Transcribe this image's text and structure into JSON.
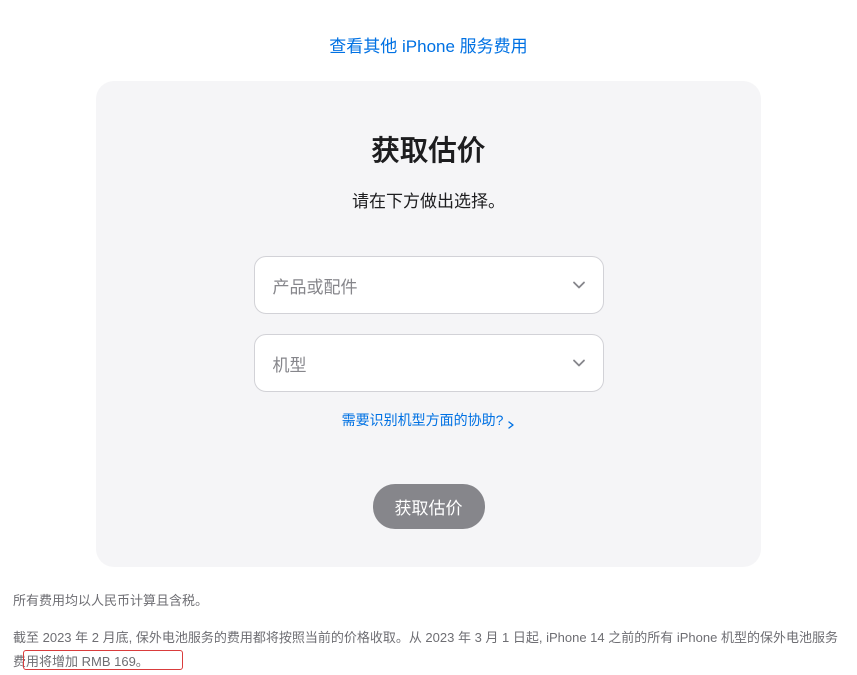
{
  "top_link": "查看其他 iPhone 服务费用",
  "card": {
    "title": "获取估价",
    "subtitle": "请在下方做出选择。",
    "select_product_placeholder": "产品或配件",
    "select_model_placeholder": "机型",
    "help_link": "需要识别机型方面的协助?",
    "submit_label": "获取估价"
  },
  "footnotes": {
    "line1": "所有费用均以人民币计算且含税。",
    "line2": "截至 2023 年 2 月底, 保外电池服务的费用都将按照当前的价格收取。从 2023 年 3 月 1 日起, iPhone 14 之前的所有 iPhone 机型的保外电池服务费用将增加 RMB 169。"
  }
}
